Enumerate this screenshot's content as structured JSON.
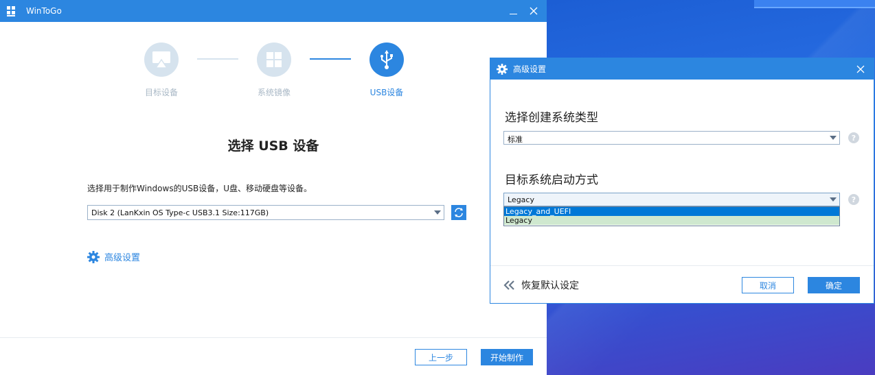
{
  "main": {
    "title": "WinToGo",
    "steps": [
      {
        "label": "目标设备",
        "icon": "monitor-icon"
      },
      {
        "label": "系统镜像",
        "icon": "windows-icon"
      },
      {
        "label": "USB设备",
        "icon": "usb-icon"
      }
    ],
    "active_step": 3,
    "heading": "选择 USB 设备",
    "description": "选择用于制作Windows的USB设备，U盘、移动硬盘等设备。",
    "disk_select_value": "Disk 2 (LanKxin OS Type-c USB3.1 Size:117GB)",
    "advanced_link": "高级设置",
    "prev_button": "上一步",
    "start_button": "开始制作"
  },
  "dialog": {
    "title": "高级设置",
    "section1_title": "选择创建系统类型",
    "type_select_value": "标准",
    "section2_title": "目标系统启动方式",
    "boot_select_value": "Legacy",
    "boot_options": [
      "Legacy_and_UEFI",
      "Legacy"
    ],
    "help_label": "?",
    "restore_label": "恢复默认设定",
    "cancel_button": "取消",
    "confirm_button": "确定"
  },
  "colors": {
    "accent": "#2c86e0",
    "step_inactive": "#d6e3ee",
    "desktop": "#2a6fe0"
  }
}
